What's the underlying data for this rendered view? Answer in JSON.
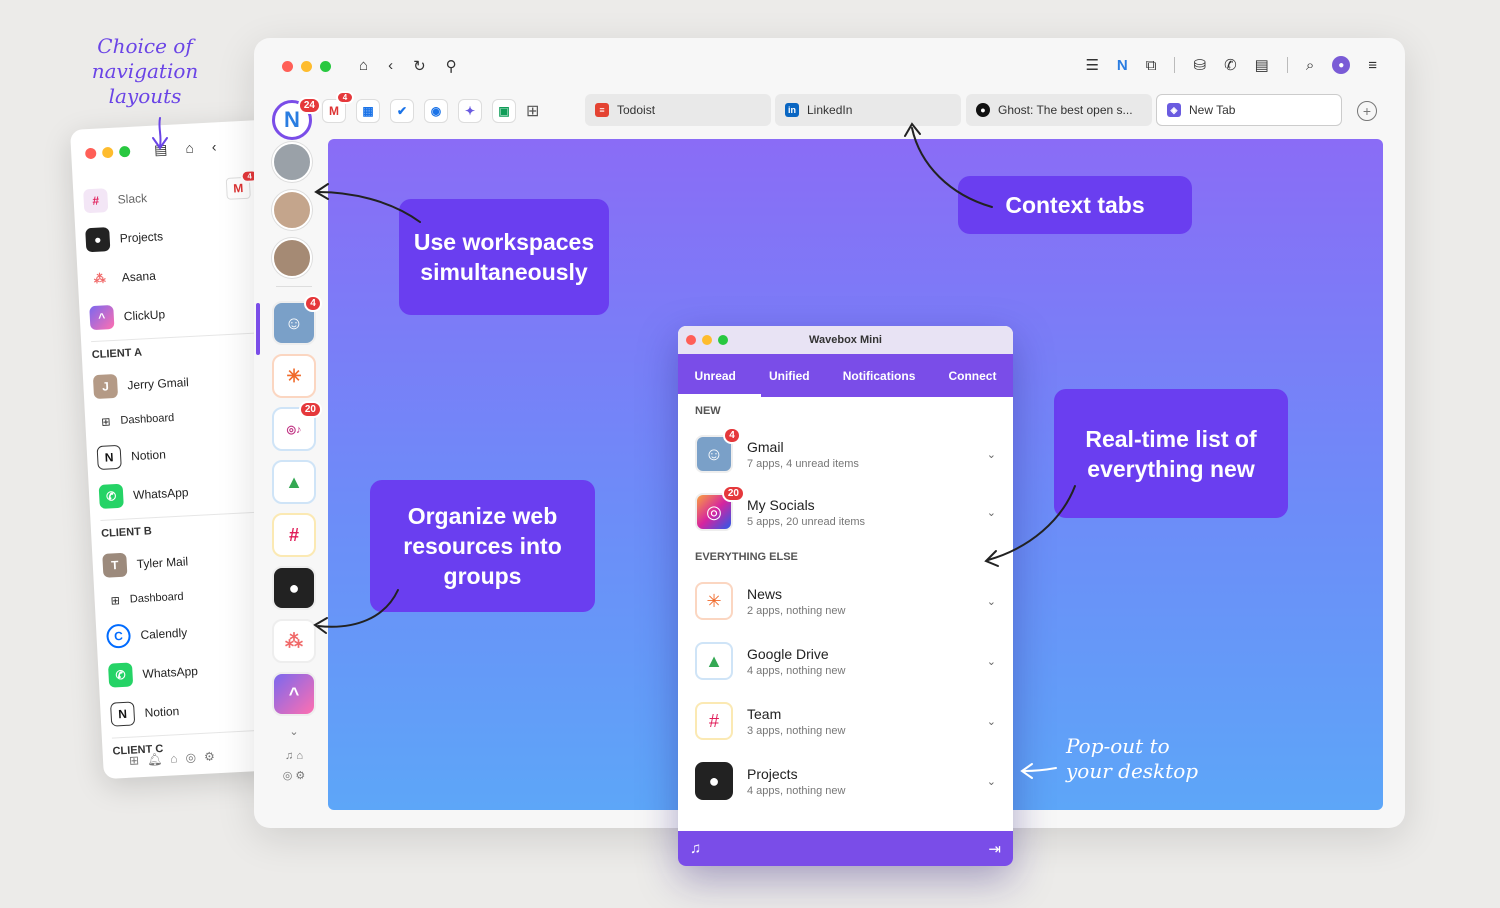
{
  "annotations": {
    "nav_layouts": "Choice of navigation layouts",
    "popout": "Pop-out to your desktop"
  },
  "left_window": {
    "mail_badge": "4",
    "items": [
      {
        "label": "Slack"
      },
      {
        "label": "Projects"
      },
      {
        "label": "Asana"
      },
      {
        "label": "ClickUp"
      }
    ],
    "group_a": "CLIENT A",
    "client_a": [
      {
        "label": "Jerry Gmail"
      },
      {
        "label": "Dashboard"
      },
      {
        "label": "Notion"
      },
      {
        "label": "WhatsApp"
      }
    ],
    "group_b": "CLIENT B",
    "client_b": [
      {
        "label": "Tyler Mail"
      },
      {
        "label": "Dashboard"
      },
      {
        "label": "Calendly"
      },
      {
        "label": "WhatsApp"
      },
      {
        "label": "Notion"
      }
    ],
    "group_c": "CLIENT C"
  },
  "main_window": {
    "n_badge": "24",
    "gmail_badge": "4",
    "context_tabs": [
      {
        "label": "Todoist"
      },
      {
        "label": "LinkedIn"
      },
      {
        "label": "Ghost: The best open s..."
      },
      {
        "label": "New Tab"
      }
    ],
    "side_badges": {
      "photo": "4",
      "socials": "20"
    }
  },
  "callouts": {
    "workspaces": "Use workspaces simultaneously",
    "context_tabs": "Context tabs",
    "organize": "Organize web resources into groups",
    "realtime": "Real-time list of everything new"
  },
  "mini": {
    "title": "Wavebox Mini",
    "tabs": [
      "Unread",
      "Unified",
      "Notifications",
      "Connect"
    ],
    "section_new": "NEW",
    "section_else": "EVERYTHING ELSE",
    "new_items": [
      {
        "name": "Gmail",
        "sub": "7 apps, 4 unread items",
        "badge": "4"
      },
      {
        "name": "My Socials",
        "sub": "5 apps, 20 unread items",
        "badge": "20"
      }
    ],
    "else_items": [
      {
        "name": "News",
        "sub": "2 apps, nothing new"
      },
      {
        "name": "Google Drive",
        "sub": "4 apps, nothing new"
      },
      {
        "name": "Team",
        "sub": "3 apps, nothing new"
      },
      {
        "name": "Projects",
        "sub": "4 apps, nothing new"
      }
    ]
  },
  "colors": {
    "accent": "#7a4de8",
    "callout": "#6a3ef0",
    "badge": "#e5383b"
  }
}
